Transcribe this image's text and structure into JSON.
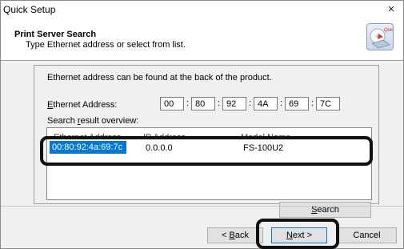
{
  "window": {
    "title": "Quick Setup",
    "close_glyph": "×"
  },
  "header": {
    "title": "Print Server Search",
    "subtitle": "Type Ethernet address or select from list.",
    "icon": "quick-setup-icon"
  },
  "panel": {
    "info_text": "Ethernet address can be found at the back of the product.",
    "ethernet_label_pre": "",
    "ethernet_label_ul": "E",
    "ethernet_label_post": "thernet Address:",
    "octets": [
      "00",
      "80",
      "92",
      "4A",
      "69",
      "7C"
    ],
    "colon": ":",
    "overview_pre": "Search ",
    "overview_ul": "r",
    "overview_post": "esult overview:",
    "columns": [
      "Ethernet Address",
      "IP Address",
      "Model Name"
    ],
    "rows": [
      {
        "ethernet": "00:80:92:4a:69:7c",
        "ip": "0.0.0.0",
        "model": "FS-100U2"
      }
    ],
    "search_ul": "S",
    "search_post": "earch"
  },
  "footer": {
    "back_pre": "< ",
    "back_ul": "B",
    "back_post": "ack",
    "next_ul": "N",
    "next_post": "ext >",
    "cancel_label": "Cancel"
  }
}
